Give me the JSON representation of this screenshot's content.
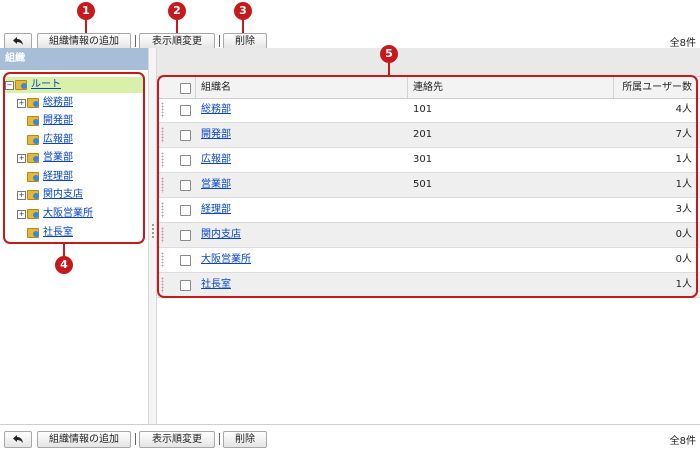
{
  "toolbar": {
    "back_icon": "back-arrow-icon",
    "add_label": "組織情報の追加",
    "reorder_label": "表示順変更",
    "delete_label": "削除",
    "count": "全8件"
  },
  "callouts": [
    "1",
    "2",
    "3",
    "4",
    "5"
  ],
  "sidebar": {
    "header": "組織",
    "root": "ルート",
    "items": [
      {
        "label": "総務部",
        "expandable": true
      },
      {
        "label": "開発部",
        "expandable": false
      },
      {
        "label": "広報部",
        "expandable": false
      },
      {
        "label": "営業部",
        "expandable": true
      },
      {
        "label": "経理部",
        "expandable": false
      },
      {
        "label": "関内支店",
        "expandable": true
      },
      {
        "label": "大阪営業所",
        "expandable": true
      },
      {
        "label": "社長室",
        "expandable": false
      }
    ]
  },
  "table": {
    "columns": [
      "組織名",
      "連絡先",
      "所属ユーザー数"
    ],
    "rows": [
      {
        "name": "総務部",
        "contact": "101",
        "users": "4人"
      },
      {
        "name": "開発部",
        "contact": "201",
        "users": "7人"
      },
      {
        "name": "広報部",
        "contact": "301",
        "users": "1人"
      },
      {
        "name": "営業部",
        "contact": "501",
        "users": "1人"
      },
      {
        "name": "経理部",
        "contact": "",
        "users": "3人"
      },
      {
        "name": "関内支店",
        "contact": "",
        "users": "0人"
      },
      {
        "name": "大阪営業所",
        "contact": "",
        "users": "0人"
      },
      {
        "name": "社長室",
        "contact": "",
        "users": "1人"
      }
    ]
  },
  "colors": {
    "callout": "#c6191b",
    "link": "#0645c7",
    "sidebar_header": "#a7bdd8",
    "root_highlight": "#d9f0a8"
  }
}
